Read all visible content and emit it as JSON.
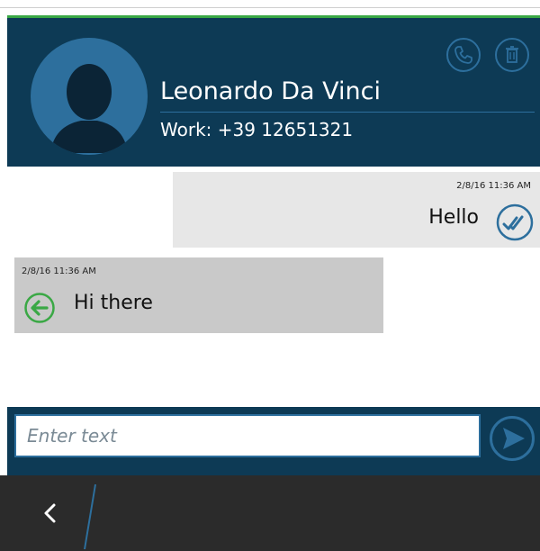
{
  "contact": {
    "name": "Leonardo Da Vinci",
    "phone": "Work: +39 12651321",
    "avatar_icon": "person-silhouette-icon"
  },
  "header_actions": [
    {
      "icon": "phone-icon",
      "label": "Call"
    },
    {
      "icon": "trash-icon",
      "label": "Delete"
    }
  ],
  "messages": [
    {
      "direction": "outgoing",
      "timestamp": "2/8/16 11:36 AM",
      "text": "Hello",
      "status_icon": "double-check-icon"
    },
    {
      "direction": "incoming",
      "timestamp": "2/8/16 11:36 AM",
      "text": "Hi there",
      "status_icon": "arrow-left-icon"
    }
  ],
  "composer": {
    "placeholder": "Enter text",
    "value": "",
    "send_icon": "send-icon"
  },
  "navigation": {
    "back_icon": "chevron-left-icon"
  },
  "colors": {
    "header_bg": "#0d3a55",
    "accent_blue": "#2d6f9d",
    "accent_green": "#3aa845",
    "outgoing_bubble": "#e7e7e7",
    "incoming_bubble": "#c9c9c9",
    "bottom_bar": "#2b2b2b"
  }
}
